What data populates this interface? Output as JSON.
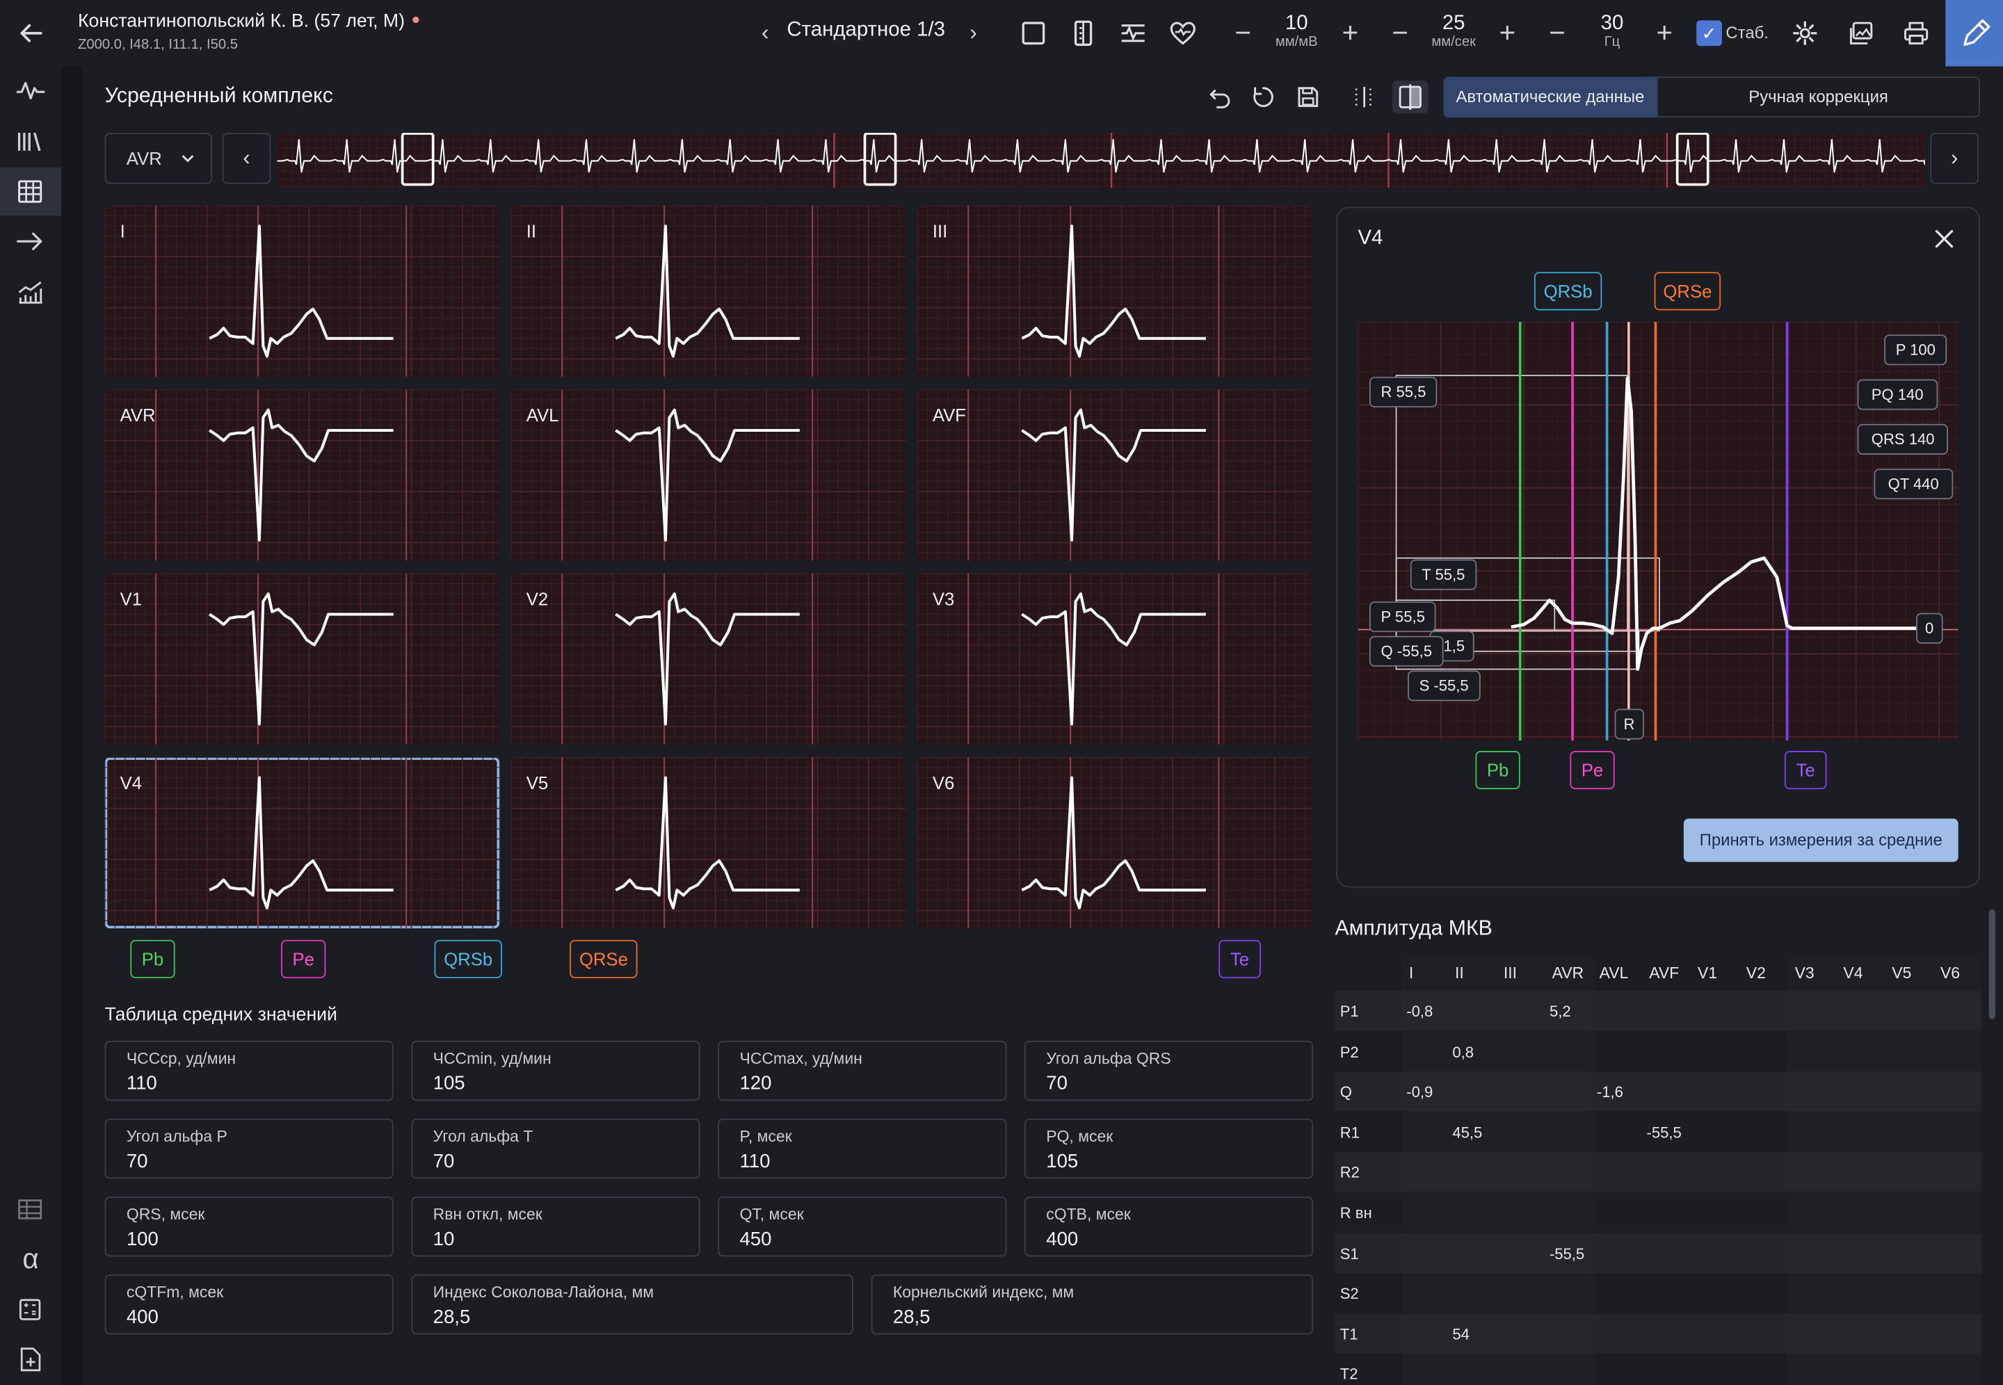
{
  "patient": {
    "name": "Константинопольский К. В.",
    "info": "(57 лет, М)",
    "codes": "Z000.0, I48.1, I11.1, I50.5"
  },
  "toolbar": {
    "view": "Стандартное 1/3",
    "gain": {
      "value": "10",
      "unit": "мм/мВ"
    },
    "speed": {
      "value": "25",
      "unit": "мм/сек"
    },
    "filter": {
      "value": "30",
      "unit": "Гц"
    },
    "stab_label": "Стаб.",
    "minus": "−",
    "plus": "+"
  },
  "section": {
    "title": "Усредненный комплекс",
    "tab_auto": "Автоматические данные",
    "tab_manual": "Ручная коррекция",
    "lead_select": "AVR"
  },
  "leads": [
    "I",
    "II",
    "III",
    "AVR",
    "AVL",
    "AVF",
    "V1",
    "V2",
    "V3",
    "V4",
    "V5",
    "V6"
  ],
  "selected_lead": "V4",
  "markers": {
    "pb": "Pb",
    "pe": "Pe",
    "qrsb": "QRSb",
    "qrse": "QRSe",
    "te": "Te"
  },
  "averages": {
    "title": "Таблица средних значений",
    "items": [
      {
        "label": "ЧССср, уд/мин",
        "value": "110"
      },
      {
        "label": "ЧССmin, уд/мин",
        "value": "105"
      },
      {
        "label": "ЧССmax, уд/мин",
        "value": "120"
      },
      {
        "label": "Угол альфа QRS",
        "value": "70"
      },
      {
        "label": "Угол альфа P",
        "value": "70"
      },
      {
        "label": "Угол альфа T",
        "value": "70"
      },
      {
        "label": "P, мсек",
        "value": "110"
      },
      {
        "label": "PQ, мсек",
        "value": "105"
      },
      {
        "label": "QRS, мсек",
        "value": "100"
      },
      {
        "label": "Rвн откл, мсек",
        "value": "10"
      },
      {
        "label": "QT, мсек",
        "value": "450"
      },
      {
        "label": "cQTB, мсек",
        "value": "400"
      },
      {
        "label": "cQTFm, мсек",
        "value": "400"
      },
      {
        "label": "Индекс Соколова-Лайона, мм",
        "value": "28,5"
      },
      {
        "label": "Корнельский индекс, мм",
        "value": "28,5"
      }
    ]
  },
  "detail": {
    "title": "V4",
    "qrsb": "QRSb",
    "qrse": "QRSe",
    "pb": "Pb",
    "pe": "Pe",
    "te": "Te",
    "r_marker": "R",
    "zero": "0",
    "amplitudes": {
      "r": "R 55,5",
      "t": "T 55,5",
      "p": "P 55,5",
      "q": "Q -55,5",
      "s": "S -55,5",
      "small": "-1,5"
    },
    "intervals": {
      "p": "P 100",
      "pq": "PQ 140",
      "qrs": "QRS 140",
      "qt": "QT 440"
    },
    "accept_button": "Принять измерения за средние"
  },
  "amplitude_table": {
    "title": "Амплитуда МКВ",
    "columns": [
      "I",
      "II",
      "III",
      "AVR",
      "AVL",
      "AVF",
      "V1",
      "V2",
      "V3",
      "V4",
      "V5",
      "V6"
    ],
    "rows": [
      {
        "name": "P1",
        "values": [
          "-0,8",
          "",
          "",
          "5,2",
          "",
          "",
          "",
          "",
          "",
          "",
          "",
          ""
        ]
      },
      {
        "name": "P2",
        "values": [
          "",
          "0,8",
          "",
          "",
          "",
          "",
          "",
          "",
          "",
          "",
          "",
          ""
        ]
      },
      {
        "name": "Q",
        "values": [
          "-0,9",
          "",
          "",
          "",
          "-1,6",
          "",
          "",
          "",
          "",
          "",
          "",
          ""
        ]
      },
      {
        "name": "R1",
        "values": [
          "",
          "45,5",
          "",
          "",
          "",
          "-55,5",
          "",
          "",
          "",
          "",
          "",
          ""
        ]
      },
      {
        "name": "R2",
        "values": [
          "",
          "",
          "",
          "",
          "",
          "",
          "",
          "",
          "",
          "",
          "",
          ""
        ]
      },
      {
        "name": "R вн",
        "values": [
          "",
          "",
          "",
          "",
          "",
          "",
          "",
          "",
          "",
          "",
          "",
          ""
        ]
      },
      {
        "name": "S1",
        "values": [
          "",
          "",
          "",
          "-55,5",
          "",
          "",
          "",
          "",
          "",
          "",
          "",
          ""
        ]
      },
      {
        "name": "S2",
        "values": [
          "",
          "",
          "",
          "",
          "",
          "",
          "",
          "",
          "",
          "",
          "",
          ""
        ]
      },
      {
        "name": "T1",
        "values": [
          "",
          "54",
          "",
          "",
          "",
          "",
          "",
          "",
          "",
          "",
          "",
          ""
        ]
      },
      {
        "name": "T2",
        "values": [
          "",
          "",
          "",
          "",
          "",
          "",
          "",
          "",
          "",
          "",
          "",
          ""
        ]
      }
    ]
  }
}
